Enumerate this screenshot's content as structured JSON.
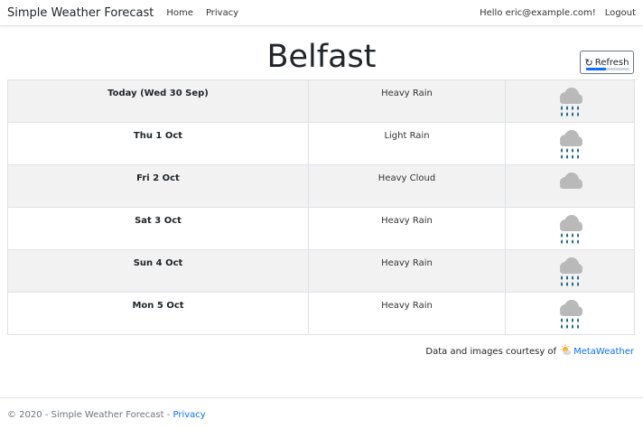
{
  "navbar": {
    "brand": "Simple Weather Forecast",
    "links": [
      "Home",
      "Privacy"
    ],
    "greeting": "Hello eric@example.com!",
    "logout": "Logout"
  },
  "city": "Belfast",
  "refresh": {
    "label": "Refresh",
    "icon": "refresh-icon",
    "progress": 0.45
  },
  "forecast": [
    {
      "day": "Today (Wed 30 Sep)",
      "condition": "Heavy Rain",
      "icon": "heavy-rain-icon"
    },
    {
      "day": "Thu 1 Oct",
      "condition": "Light Rain",
      "icon": "light-rain-icon"
    },
    {
      "day": "Fri 2 Oct",
      "condition": "Heavy Cloud",
      "icon": "heavy-cloud-icon"
    },
    {
      "day": "Sat 3 Oct",
      "condition": "Heavy Rain",
      "icon": "heavy-rain-icon"
    },
    {
      "day": "Sun 4 Oct",
      "condition": "Heavy Rain",
      "icon": "heavy-rain-icon"
    },
    {
      "day": "Mon 5 Oct",
      "condition": "Heavy Rain",
      "icon": "heavy-rain-icon"
    }
  ],
  "credit": {
    "text": "Data and images courtesy of",
    "link": "MetaWeather",
    "icon": "metaweather-logo-icon"
  },
  "footer": {
    "text": "© 2020 - Simple Weather Forecast - ",
    "link": "Privacy"
  },
  "colors": {
    "accent": "#0d6efd",
    "stripe": "#f2f2f2",
    "cloud": "#b9b9b9",
    "rain": "#0e5e7d"
  }
}
